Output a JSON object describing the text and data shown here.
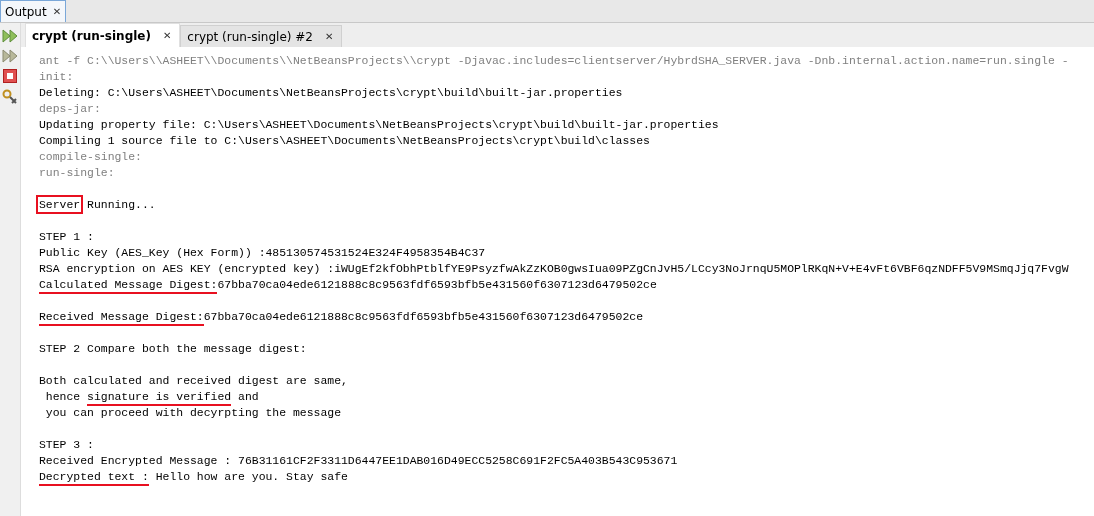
{
  "window": {
    "title": "Output",
    "close": "✕"
  },
  "tabs": [
    {
      "label": "crypt (run-single)",
      "close": "✕",
      "selected": true
    },
    {
      "label": "crypt (run-single) #2",
      "close": "✕",
      "selected": false
    }
  ],
  "console": {
    "lines": [
      {
        "kind": "info",
        "segments": [
          {
            "text": "ant -f C:\\\\Users\\\\ASHEET\\\\Documents\\\\NetBeansProjects\\\\crypt -Djavac.includes=clientserver/HybrdSHA_SERVER.java -Dnb.internal.action.name=run.single -"
          }
        ]
      },
      {
        "kind": "info",
        "segments": [
          {
            "text": "init:"
          }
        ]
      },
      {
        "kind": "output",
        "segments": [
          {
            "text": "Deleting: C:\\Users\\ASHEET\\Documents\\NetBeansProjects\\crypt\\build\\built-jar.properties"
          }
        ]
      },
      {
        "kind": "info",
        "segments": [
          {
            "text": "deps-jar:"
          }
        ]
      },
      {
        "kind": "output",
        "segments": [
          {
            "text": "Updating property file: C:\\Users\\ASHEET\\Documents\\NetBeansProjects\\crypt\\build\\built-jar.properties"
          }
        ]
      },
      {
        "kind": "output",
        "segments": [
          {
            "text": "Compiling 1 source file to C:\\Users\\ASHEET\\Documents\\NetBeansProjects\\crypt\\build\\classes"
          }
        ]
      },
      {
        "kind": "info",
        "segments": [
          {
            "text": "compile-single:"
          }
        ]
      },
      {
        "kind": "info",
        "segments": [
          {
            "text": "run-single:"
          }
        ]
      },
      {
        "kind": "blank"
      },
      {
        "kind": "output",
        "segments": [
          {
            "text": "Server",
            "kind": "boxed"
          },
          {
            "text": " Running..."
          }
        ]
      },
      {
        "kind": "blank"
      },
      {
        "kind": "output",
        "segments": [
          {
            "text": "STEP 1 :"
          }
        ]
      },
      {
        "kind": "output",
        "segments": [
          {
            "text": "Public Key (AES_Key (Hex Form)) :485130574531524E324F4958354B4C37"
          }
        ]
      },
      {
        "kind": "output",
        "segments": [
          {
            "text": "RSA encryption on AES KEY (encrypted key) :iWUgEf2kfObhPtblfYE9PsyzfwAkZzKOB0gwsIua09PZgCnJvH5/LCcy3NoJrnqU5MOPlRKqN+V+E4vFt6VBF6qzNDFF5V9MSmqJjq7FvgW"
          }
        ]
      },
      {
        "kind": "output",
        "segments": [
          {
            "text": "Calculated Message Digest:",
            "kind": "underlined"
          },
          {
            "text": "67bba70ca04ede6121888c8c9563fdf6593bfb5e431560f6307123d6479502ce"
          }
        ]
      },
      {
        "kind": "blank"
      },
      {
        "kind": "output",
        "segments": [
          {
            "text": "Received Message Digest:",
            "kind": "underlined"
          },
          {
            "text": "67bba70ca04ede6121888c8c9563fdf6593bfb5e431560f6307123d6479502ce"
          }
        ]
      },
      {
        "kind": "blank"
      },
      {
        "kind": "output",
        "segments": [
          {
            "text": "STEP 2 Compare both the message digest:"
          }
        ]
      },
      {
        "kind": "blank"
      },
      {
        "kind": "output",
        "segments": [
          {
            "text": "Both calculated and received digest are same,"
          }
        ]
      },
      {
        "kind": "output",
        "segments": [
          {
            "text": " hence "
          },
          {
            "text": "signature is verified",
            "kind": "underlined"
          },
          {
            "text": " and"
          }
        ]
      },
      {
        "kind": "output",
        "segments": [
          {
            "text": " you can proceed with decyrpting the message"
          }
        ]
      },
      {
        "kind": "blank"
      },
      {
        "kind": "output",
        "segments": [
          {
            "text": "STEP 3 :"
          }
        ]
      },
      {
        "kind": "output",
        "segments": [
          {
            "text": "Received Encrypted Message : 76B31161CF2F3311D6447EE1DAB016D49ECC5258C691F2FC5A403B543C953671"
          }
        ]
      },
      {
        "kind": "output",
        "segments": [
          {
            "text": "Decrypted text :",
            "kind": "underlined"
          },
          {
            "text": " Hello how are you. Stay safe"
          }
        ]
      }
    ]
  }
}
